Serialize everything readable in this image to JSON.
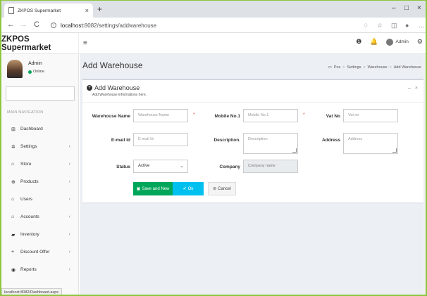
{
  "browser": {
    "tab_title": "ZKPOS Supermarket",
    "tab_close": "×",
    "new_tab": "+",
    "url_host": "localhost",
    "url_rest": ":8082/settings/addwarehouse",
    "window_controls": [
      "–",
      "□",
      "×"
    ]
  },
  "header": {
    "brand": "ZKPOS Supermarket",
    "menu_icon": "≡",
    "user_name": "Admin",
    "notification_count": ""
  },
  "sidebar": {
    "user_name": "Admin",
    "user_status": "Online",
    "nav_header": "MAIN NAVIGATION",
    "items": [
      {
        "label": "Dashboard",
        "icon": "⊞",
        "chevron": ""
      },
      {
        "label": "Settings",
        "icon": "✲",
        "chevron": "‹"
      },
      {
        "label": "Store",
        "icon": "⌂",
        "chevron": "‹"
      },
      {
        "label": "Products",
        "icon": "⊕",
        "chevron": "‹"
      },
      {
        "label": "Users",
        "icon": "⌂",
        "chevron": "‹"
      },
      {
        "label": "Accounts",
        "icon": "⌂",
        "chevron": "‹"
      },
      {
        "label": "Inventory",
        "icon": "▰",
        "chevron": "‹"
      },
      {
        "label": "Discount Offer",
        "icon": "+",
        "chevron": "‹"
      },
      {
        "label": "Reports",
        "icon": "◉",
        "chevron": "‹"
      }
    ],
    "status_url": "localhost:8082/Dashboard.aspx"
  },
  "page": {
    "title": "Add Warehouse",
    "breadcrumb": [
      "Pos",
      "Settings",
      "Warehouse",
      "Add Warehouse"
    ]
  },
  "form": {
    "title": "Add Warehouse",
    "subtitle": "Add Warehouse informations here.",
    "tools": [
      "–",
      "×"
    ],
    "warehouse_name_label": "Warehouse Name",
    "warehouse_name_placeholder": "Warehouse Name",
    "mobile_label": "Mobile No.1",
    "mobile_placeholder": "Mobile No.1",
    "vat_label": "Vat No",
    "vat_placeholder": "Vat no",
    "email_label": "E-mail Id",
    "email_placeholder": "E-mail Id",
    "description_label": "Description.",
    "description_placeholder": "Description.",
    "address_label": "Address",
    "address_placeholder": "Address",
    "status_label": "Status",
    "status_value": "Active",
    "company_label": "Company",
    "company_value": "Company name",
    "required_mark": "*",
    "save_new_label": "Save and New",
    "ok_label": "Ok",
    "cancel_label": "Cancel"
  },
  "colors": {
    "frame": "#8cc63f",
    "save": "#00a65a",
    "ok": "#00c0ef",
    "required": "#dd4b39"
  }
}
